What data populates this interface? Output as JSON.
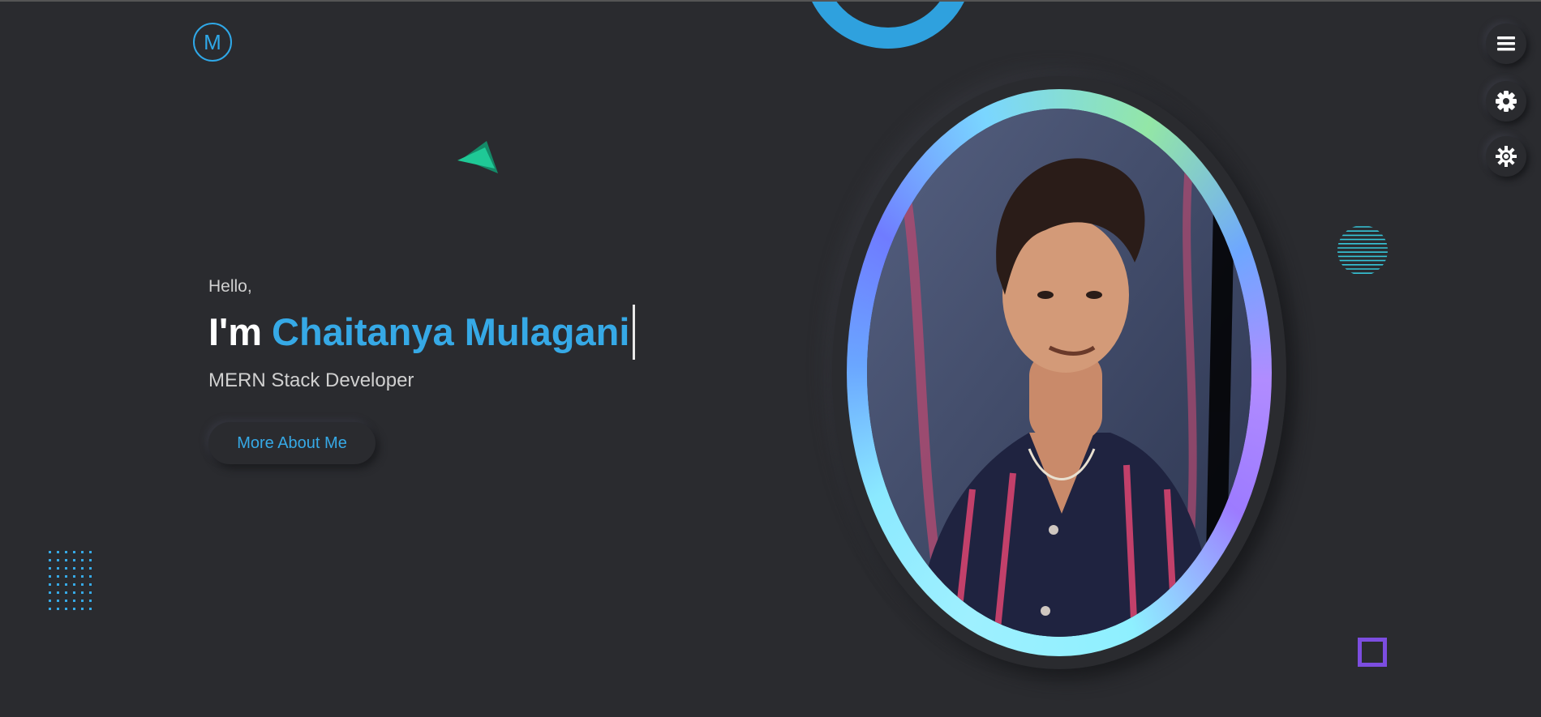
{
  "logo": {
    "letter": "M"
  },
  "hero": {
    "greeting": "Hello,",
    "im": "I'm",
    "name": "Chaitanya Mulagani",
    "role": "MERN Stack Developer",
    "cta_label": "More About Me"
  },
  "side_controls": [
    {
      "icon": "menu-icon"
    },
    {
      "icon": "gear-icon"
    },
    {
      "icon": "sun-icon"
    }
  ],
  "colors": {
    "background": "#2a2b2f",
    "accent": "#36a9e6",
    "triangle": "#1fc996",
    "square": "#7c4de0"
  }
}
